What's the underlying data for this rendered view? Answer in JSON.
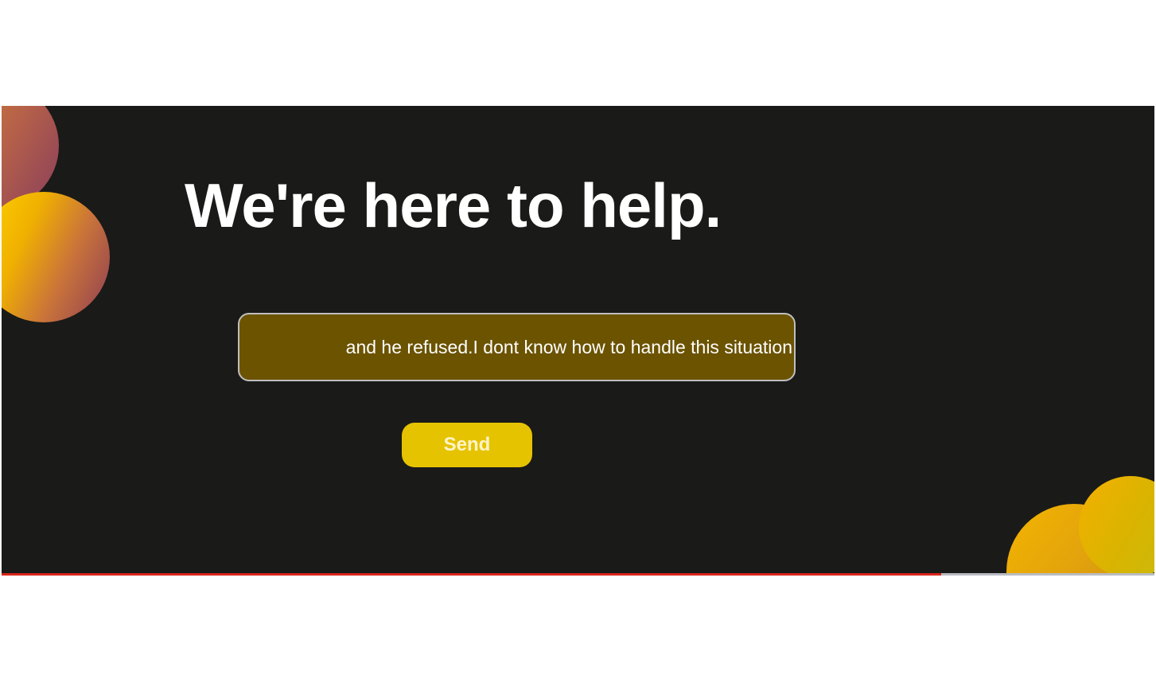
{
  "hero": {
    "title": "We're here to help."
  },
  "message_input": {
    "value": "and he refused.I dont know how to handle this situation"
  },
  "send_button": {
    "label": "Send"
  },
  "progress": {
    "fraction": 0.815
  },
  "colors": {
    "background": "#1a1a18",
    "input_fill": "#6b5300",
    "button": "#e6c300",
    "progress_fill": "#d9261c"
  }
}
